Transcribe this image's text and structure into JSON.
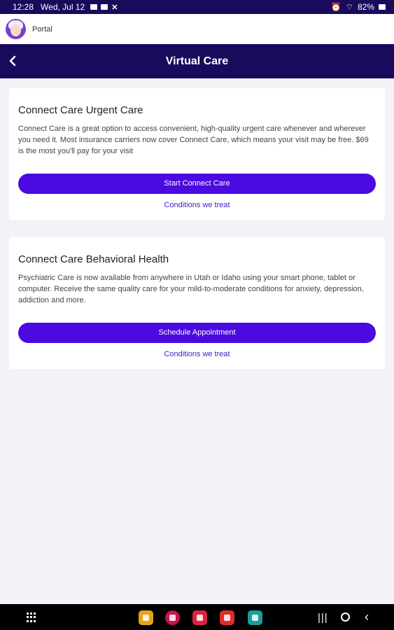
{
  "status_bar": {
    "time": "12:28",
    "date": "Wed, Jul 12",
    "battery": "82%"
  },
  "portal": {
    "label": "Portal"
  },
  "app_bar": {
    "title": "Virtual Care",
    "back_icon": "chevron-left-icon"
  },
  "cards": [
    {
      "title": "Connect Care Urgent Care",
      "description": "Connect Care is a great option to access convenient, high-quality urgent care whenever and wherever you need it. Most insurance carriers now cover Connect Care, which means your visit may be free. $69 is the most you'll pay for your visit",
      "button_label": "Start Connect Care",
      "link_label": "Conditions we treat"
    },
    {
      "title": "Connect Care Behavioral Health",
      "description": "Psychiatric Care is now available from anywhere in Utah or Idaho using your smart phone, tablet or computer. Receive the same quality care for your mild-to-moderate conditions for anxiety, depression, addiction and more.",
      "button_label": "Schedule Appointment",
      "link_label": "Conditions we treat"
    }
  ],
  "colors": {
    "primary": "#4a0ae0",
    "header": "#1a0a5c",
    "link": "#3f20c8",
    "background": "#f4f2f7"
  }
}
